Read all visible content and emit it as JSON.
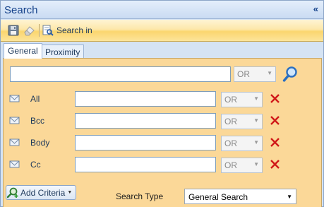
{
  "panel": {
    "title": "Search",
    "collapse_glyph": "«"
  },
  "toolbar": {
    "save_icon": "floppy-disk-icon",
    "clear_icon": "eraser-icon",
    "search_in_label": "Search in"
  },
  "tabs": [
    {
      "label": "General",
      "selected": true
    },
    {
      "label": "Proximity",
      "selected": false
    }
  ],
  "main_search": {
    "value": "",
    "operator": "OR"
  },
  "criteria": [
    {
      "label": "All",
      "value": "",
      "operator": "OR"
    },
    {
      "label": "Bcc",
      "value": "",
      "operator": "OR"
    },
    {
      "label": "Body",
      "value": "",
      "operator": "OR"
    },
    {
      "label": "Cc",
      "value": "",
      "operator": "OR"
    }
  ],
  "add_criteria_label": "Add Criteria",
  "search_type": {
    "label": "Search Type",
    "value": "General Search"
  },
  "colors": {
    "accent": "#15428b",
    "content_bg": "#fbd898",
    "delete": "#d01a1a"
  }
}
